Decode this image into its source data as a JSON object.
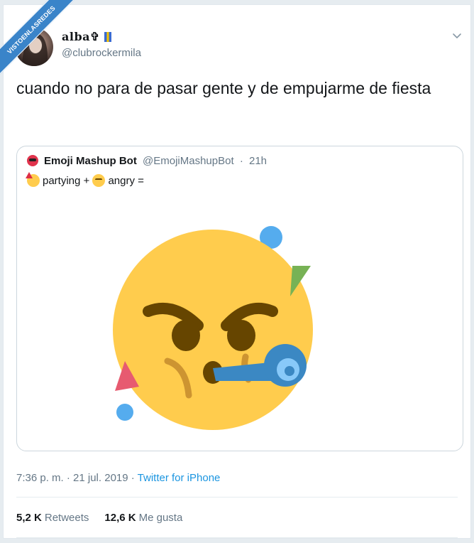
{
  "watermark": "VISTOENLASREDES",
  "author": {
    "display_name": "alba✞",
    "handle": "@clubrockermila"
  },
  "tweet_text": "cuando no para de pasar gente y de empujarme de fiesta",
  "quoted": {
    "name": "Emoji Mashup Bot",
    "handle": "@EmojiMashupBot",
    "separator": "·",
    "age": "21h",
    "text_part1": "partying +",
    "text_part2": "angry ="
  },
  "meta": {
    "time": "7:36 p. m. · 21 jul. 2019 ·",
    "client": "Twitter for iPhone"
  },
  "stats": {
    "retweets_count": "5,2 K",
    "retweets_label": "Retweets",
    "likes_count": "12,6 K",
    "likes_label": "Me gusta"
  },
  "colors": {
    "link": "#1b95e0",
    "muted": "#657786",
    "emoji_face": "#ffcc4d",
    "brow": "#664500",
    "horn": "#3b88c3"
  },
  "icons": [
    "chevron-down-icon",
    "bot-avatar-icon",
    "partying-emoji-icon",
    "angry-emoji-icon"
  ]
}
